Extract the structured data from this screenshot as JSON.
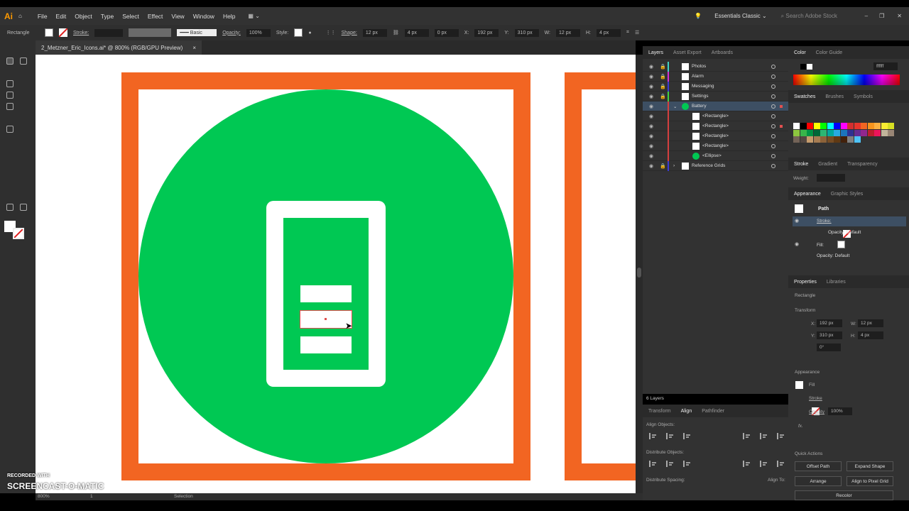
{
  "app": {
    "logo": "Ai",
    "menu": [
      "File",
      "Edit",
      "Object",
      "Type",
      "Select",
      "Effect",
      "View",
      "Window",
      "Help"
    ],
    "workspace": "Essentials Classic",
    "search_placeholder": "Search Adobe Stock"
  },
  "control_bar": {
    "tool": "Rectangle",
    "stroke_label": "Stroke:",
    "brush": "Basic",
    "opacity_label": "Opacity:",
    "opacity": "100%",
    "style_label": "Style:",
    "shape_label": "Shape:",
    "shape_w": "12 px",
    "shape_h": "4 px",
    "corner": "0 px",
    "x_label": "X:",
    "x": "192 px",
    "y_label": "Y:",
    "y": "310 px",
    "w_label": "W:",
    "w": "12 px",
    "h_label": "H:",
    "h": "4 px"
  },
  "document": {
    "tab_title": "2_Metzner_Eric_Icons.ai* @ 800% (RGB/GPU Preview)",
    "close": "×"
  },
  "status": {
    "zoom": "800%",
    "artboard": "1",
    "tool": "Selection"
  },
  "colors": {
    "orange": "#f26522",
    "green": "#00c853",
    "panel": "#323232"
  },
  "layers": {
    "tabs": [
      "Layers",
      "Asset Export",
      "Artboards"
    ],
    "items": [
      {
        "name": "Photos",
        "color": "#3fd4c4",
        "locked": true
      },
      {
        "name": "Alarm",
        "color": "#d42fd4",
        "locked": true
      },
      {
        "name": "Messaging",
        "color": "#3b3bd4",
        "locked": true
      },
      {
        "name": "Settings",
        "color": "#3fd43f",
        "locked": true
      },
      {
        "name": "Battery",
        "color": "#d43f3f",
        "locked": false,
        "selected": true
      },
      {
        "name": "<Rectangle>",
        "color": "#d43f3f",
        "sub": true
      },
      {
        "name": "<Rectangle>",
        "color": "#d43f3f",
        "sub": true
      },
      {
        "name": "<Rectangle>",
        "color": "#d43f3f",
        "sub": true
      },
      {
        "name": "<Rectangle>",
        "color": "#d43f3f",
        "sub": true
      },
      {
        "name": "<Ellipse>",
        "color": "#d43f3f",
        "sub": true
      },
      {
        "name": "Reference Grids",
        "color": "#3b3bd4",
        "locked": true
      }
    ],
    "count": "6 Layers"
  },
  "align": {
    "tabs": [
      "Transform",
      "Align",
      "Pathfinder"
    ],
    "align_objects": "Align Objects:",
    "distribute_objects": "Distribute Objects:",
    "distribute_spacing": "Distribute Spacing:",
    "align_to": "Align To:"
  },
  "color_panel": {
    "tabs": [
      "Color",
      "Color Guide"
    ],
    "hex": "ffffff"
  },
  "swatches": {
    "tabs": [
      "Swatches",
      "Brushes",
      "Symbols"
    ],
    "colors": [
      "#ffffff",
      "#000000",
      "#ff0000",
      "#ffff00",
      "#00ff00",
      "#00ffff",
      "#0000ff",
      "#ff00ff",
      "#d42f2f",
      "#e8352b",
      "#f26522",
      "#f7941d",
      "#fbb040",
      "#f9ed32",
      "#d7df23",
      "#8dc63f",
      "#39b54a",
      "#009444",
      "#006838",
      "#2bb673",
      "#00a79d",
      "#27aae1",
      "#1c75bc",
      "#2e3192",
      "#662d91",
      "#92278f",
      "#be1e2d",
      "#ed145b",
      "#c2b59b",
      "#998675",
      "#736357",
      "#534741",
      "#c69c6d",
      "#a67c52",
      "#8c6239",
      "#754c24",
      "#603913",
      "#42210b",
      "#808080",
      "#4fc3f7"
    ]
  },
  "stroke_panel": {
    "tabs": [
      "Stroke",
      "Gradient",
      "Transparency"
    ],
    "weight_label": "Weight:"
  },
  "appearance": {
    "tabs": [
      "Appearance",
      "Graphic Styles"
    ],
    "object": "Path",
    "stroke": "Stroke:",
    "opacity1": "Opacity:",
    "opacity1_val": "Default",
    "fill": "Fill:",
    "opacity2": "Opacity:",
    "opacity2_val": "Default"
  },
  "properties": {
    "tabs": [
      "Properties",
      "Libraries"
    ],
    "object": "Rectangle",
    "transform": "Transform",
    "x_label": "X:",
    "x": "192 px",
    "y_label": "Y:",
    "y": "310 px",
    "w_label": "W:",
    "w": "12 px",
    "h_label": "H:",
    "h": "4 px",
    "angle": "0°",
    "appearance": "Appearance",
    "fill": "Fill",
    "stroke": "Stroke",
    "opacity": "Opacity",
    "opacity_val": "100%",
    "fx": "fx.",
    "quick_actions": "Quick Actions",
    "actions": [
      "Offset Path",
      "Expand Shape",
      "Arrange",
      "Align to Pixel Grid",
      "Recolor"
    ]
  },
  "watermark": {
    "line1": "RECORDED WITH",
    "line2": "SCREENCAST-O-MATIC"
  }
}
